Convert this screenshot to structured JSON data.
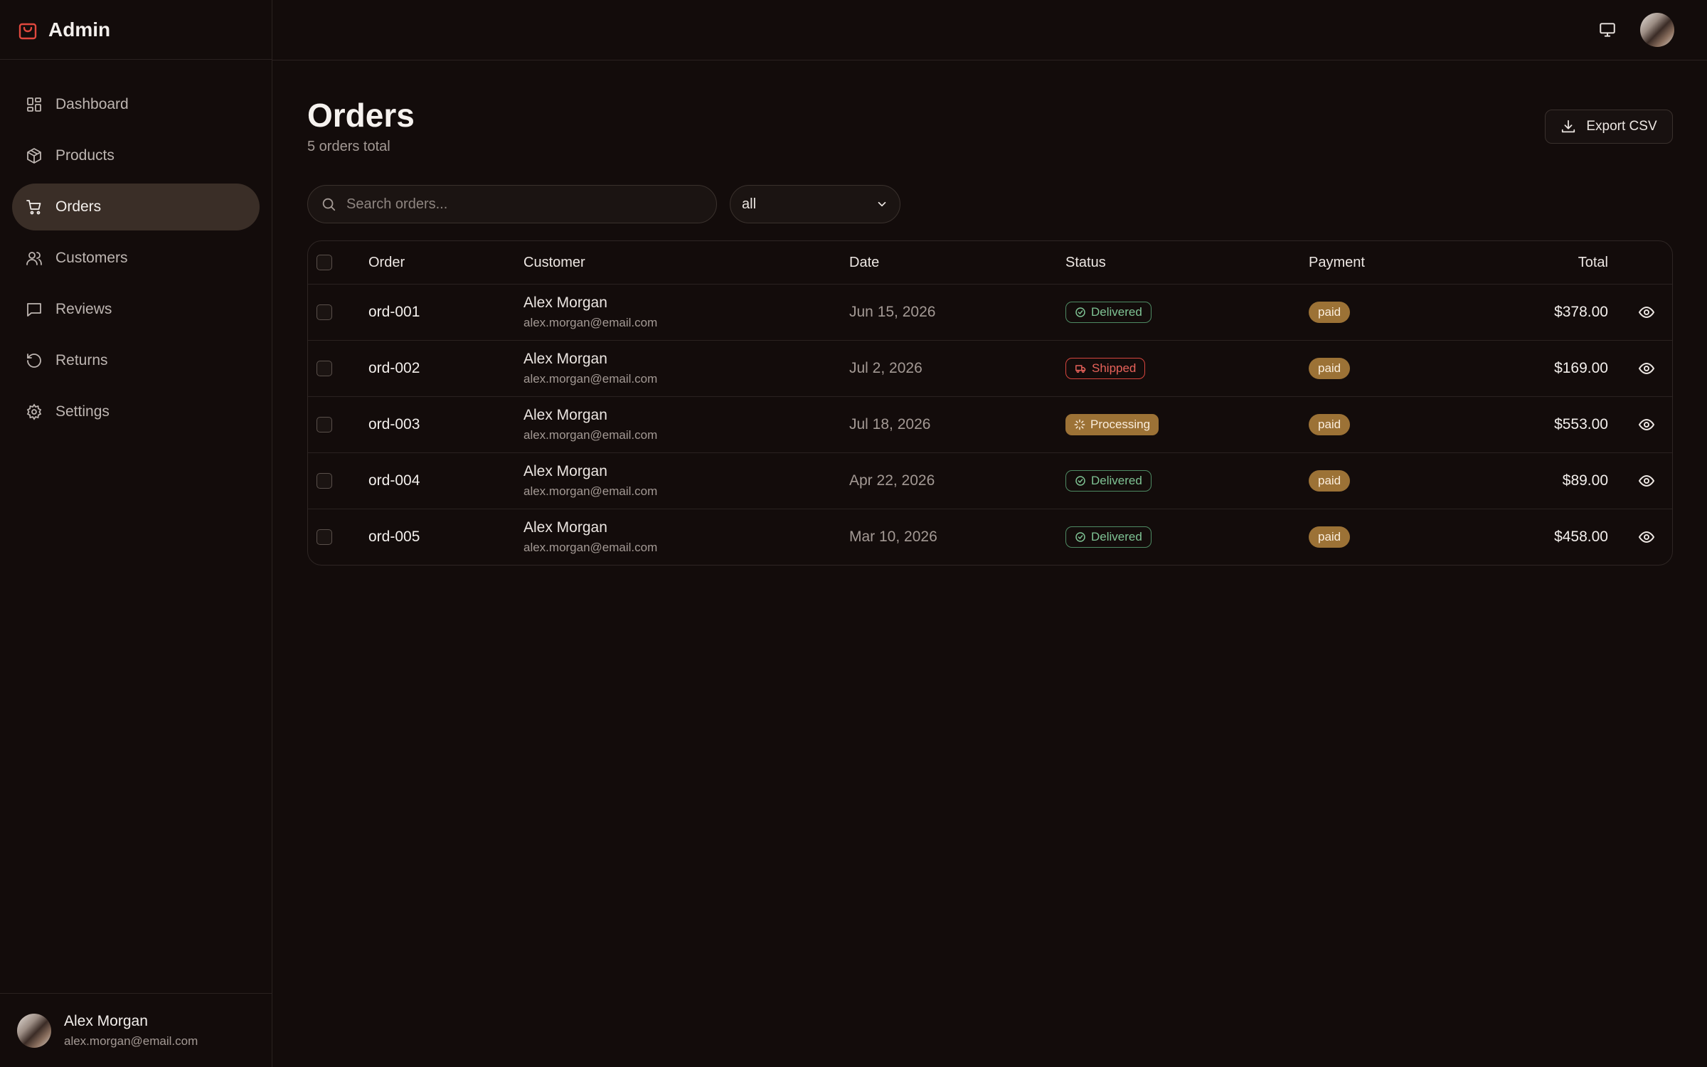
{
  "app": {
    "title": "Admin",
    "brand_color": "#e0483e"
  },
  "sidebar": {
    "items": [
      {
        "label": "Dashboard",
        "icon": "dashboard-icon",
        "active": false
      },
      {
        "label": "Products",
        "icon": "package-icon",
        "active": false
      },
      {
        "label": "Orders",
        "icon": "cart-icon",
        "active": true
      },
      {
        "label": "Customers",
        "icon": "users-icon",
        "active": false
      },
      {
        "label": "Reviews",
        "icon": "message-icon",
        "active": false
      },
      {
        "label": "Returns",
        "icon": "rotate-icon",
        "active": false
      },
      {
        "label": "Settings",
        "icon": "gear-icon",
        "active": false
      }
    ],
    "user": {
      "name": "Alex Morgan",
      "email": "alex.morgan@email.com"
    }
  },
  "topbar": {
    "icons": [
      "monitor-icon",
      "avatar"
    ]
  },
  "page": {
    "title": "Orders",
    "subtitle": "5 orders total",
    "export_label": "Export CSV"
  },
  "filters": {
    "search_placeholder": "Search orders...",
    "status_value": "all"
  },
  "table": {
    "columns": {
      "order": "Order",
      "customer": "Customer",
      "date": "Date",
      "status": "Status",
      "payment": "Payment",
      "total": "Total"
    },
    "rows": [
      {
        "order": "ord-001",
        "customer_name": "Alex Morgan",
        "customer_email": "alex.morgan@email.com",
        "date": "Jun 15, 2026",
        "status": "Delivered",
        "payment": "paid",
        "total": "$378.00"
      },
      {
        "order": "ord-002",
        "customer_name": "Alex Morgan",
        "customer_email": "alex.morgan@email.com",
        "date": "Jul 2, 2026",
        "status": "Shipped",
        "payment": "paid",
        "total": "$169.00"
      },
      {
        "order": "ord-003",
        "customer_name": "Alex Morgan",
        "customer_email": "alex.morgan@email.com",
        "date": "Jul 18, 2026",
        "status": "Processing",
        "payment": "paid",
        "total": "$553.00"
      },
      {
        "order": "ord-004",
        "customer_name": "Alex Morgan",
        "customer_email": "alex.morgan@email.com",
        "date": "Apr 22, 2026",
        "status": "Delivered",
        "payment": "paid",
        "total": "$89.00"
      },
      {
        "order": "ord-005",
        "customer_name": "Alex Morgan",
        "customer_email": "alex.morgan@email.com",
        "date": "Mar 10, 2026",
        "status": "Delivered",
        "payment": "paid",
        "total": "$458.00"
      }
    ]
  },
  "colors": {
    "background": "#130c0b",
    "active_nav": "#3a2e27",
    "delivered": "#7fc394",
    "shipped": "#e7625a",
    "processing": "#9c7236",
    "paid": "#9c7236"
  }
}
